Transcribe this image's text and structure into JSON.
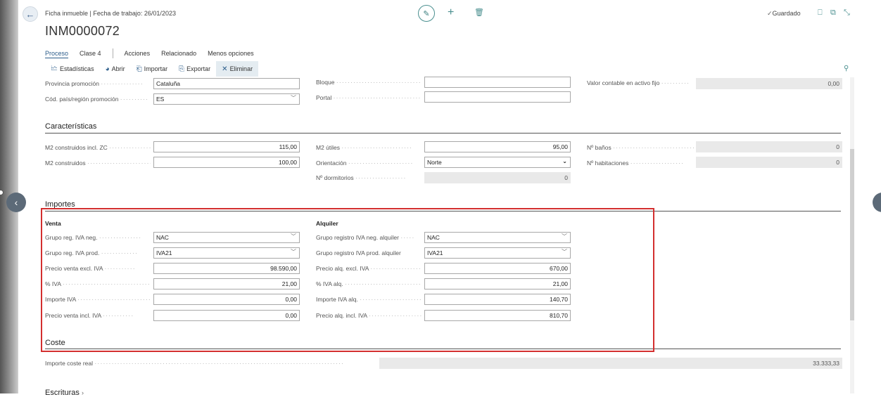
{
  "header": {
    "breadcrumb": "Ficha inmueble | Fecha de trabajo: 26/01/2023",
    "title": "INM0000072",
    "saved": "Guardado",
    "back_icon": "arrow-left-icon"
  },
  "tabs": {
    "proceso": "Proceso",
    "clase": "Clase 4",
    "acciones": "Acciones",
    "relacionado": "Relacionado",
    "menos": "Menos opciones"
  },
  "toolbar": {
    "estadisticas": "Estadísticas",
    "abrir": "Abrir",
    "importar": "Importar",
    "exportar": "Exportar",
    "eliminar": "Eliminar"
  },
  "general": {
    "provincia_label": "Provincia promoción",
    "provincia_value": "Cataluña",
    "pais_label": "Cód. país/región promoción",
    "pais_value": "ES",
    "bloque_label": "Bloque",
    "bloque_value": "",
    "portal_label": "Portal",
    "portal_value": "",
    "valor_label": "Valor contable en activo fijo",
    "valor_value": "0,00"
  },
  "caracteristicas": {
    "title": "Características",
    "m2_zc_label": "M2 construidos incl. ZC",
    "m2_zc_value": "115,00",
    "m2_const_label": "M2 construidos",
    "m2_const_value": "100,00",
    "m2_utiles_label": "M2 útiles",
    "m2_utiles_value": "95,00",
    "orientacion_label": "Orientación",
    "orientacion_value": "Norte",
    "dormitorios_label": "Nº dormitorios",
    "dormitorios_value": "0",
    "banos_label": "Nº baños",
    "banos_value": "0",
    "habitaciones_label": "Nº habitaciones",
    "habitaciones_value": "0"
  },
  "importes": {
    "title": "Importes",
    "venta": {
      "heading": "Venta",
      "grupo_neg_label": "Grupo reg. IVA neg.",
      "grupo_neg_value": "NAC",
      "grupo_prod_label": "Grupo reg. IVA prod.",
      "grupo_prod_value": "IVA21",
      "precio_excl_label": "Precio venta excl. IVA",
      "precio_excl_value": "98.590,00",
      "iva_label": "% IVA",
      "iva_value": "21,00",
      "importe_iva_label": "Importe IVA",
      "importe_iva_value": "0,00",
      "precio_incl_label": "Precio venta incl. IVA",
      "precio_incl_value": "0,00"
    },
    "alquiler": {
      "heading": "Alquiler",
      "grupo_neg_label": "Grupo registro IVA neg. alquiler",
      "grupo_neg_value": "NAC",
      "grupo_prod_label": "Grupo registro IVA prod. alquiler",
      "grupo_prod_value": "IVA21",
      "precio_excl_label": "Precio alq. excl. IVA",
      "precio_excl_value": "670,00",
      "iva_label": "% IVA alq.",
      "iva_value": "21,00",
      "importe_iva_label": "Importe IVA alq.",
      "importe_iva_value": "140,70",
      "precio_incl_label": "Precio alq. incl. IVA",
      "precio_incl_value": "810,70"
    }
  },
  "coste": {
    "title": "Coste",
    "importe_label": "Importe coste real",
    "importe_value": "33.333,33"
  },
  "next_section": "Escrituras",
  "colors": {
    "accent": "#2b5c8a",
    "highlight_border": "#d32f2f",
    "teal": "#4a8f8f"
  }
}
